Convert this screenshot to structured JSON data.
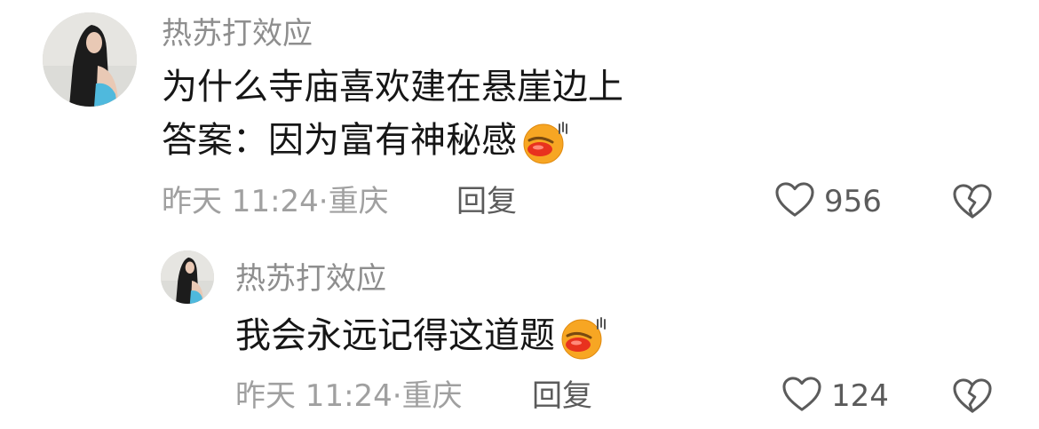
{
  "comment": {
    "username": "热苏打效应",
    "lines": [
      "为什么寺庙喜欢建在悬崖边上",
      "答案：因为富有神秘感"
    ],
    "time": "昨天 11:24",
    "location": "重庆",
    "reply_label": "回复",
    "likes": "956"
  },
  "reply": {
    "username": "热苏打效应",
    "text": "我会永远记得这道题",
    "time": "昨天 11:24",
    "location": "重庆",
    "reply_label": "回复",
    "likes": "124"
  },
  "icons": {
    "emoji": "drooling-lips-emoji",
    "like": "heart-outline-icon",
    "dislike": "broken-heart-icon"
  },
  "colors": {
    "username": "#8e8e8e",
    "text": "#161616",
    "meta": "#a0a0a0",
    "action": "#5b5b5b"
  }
}
